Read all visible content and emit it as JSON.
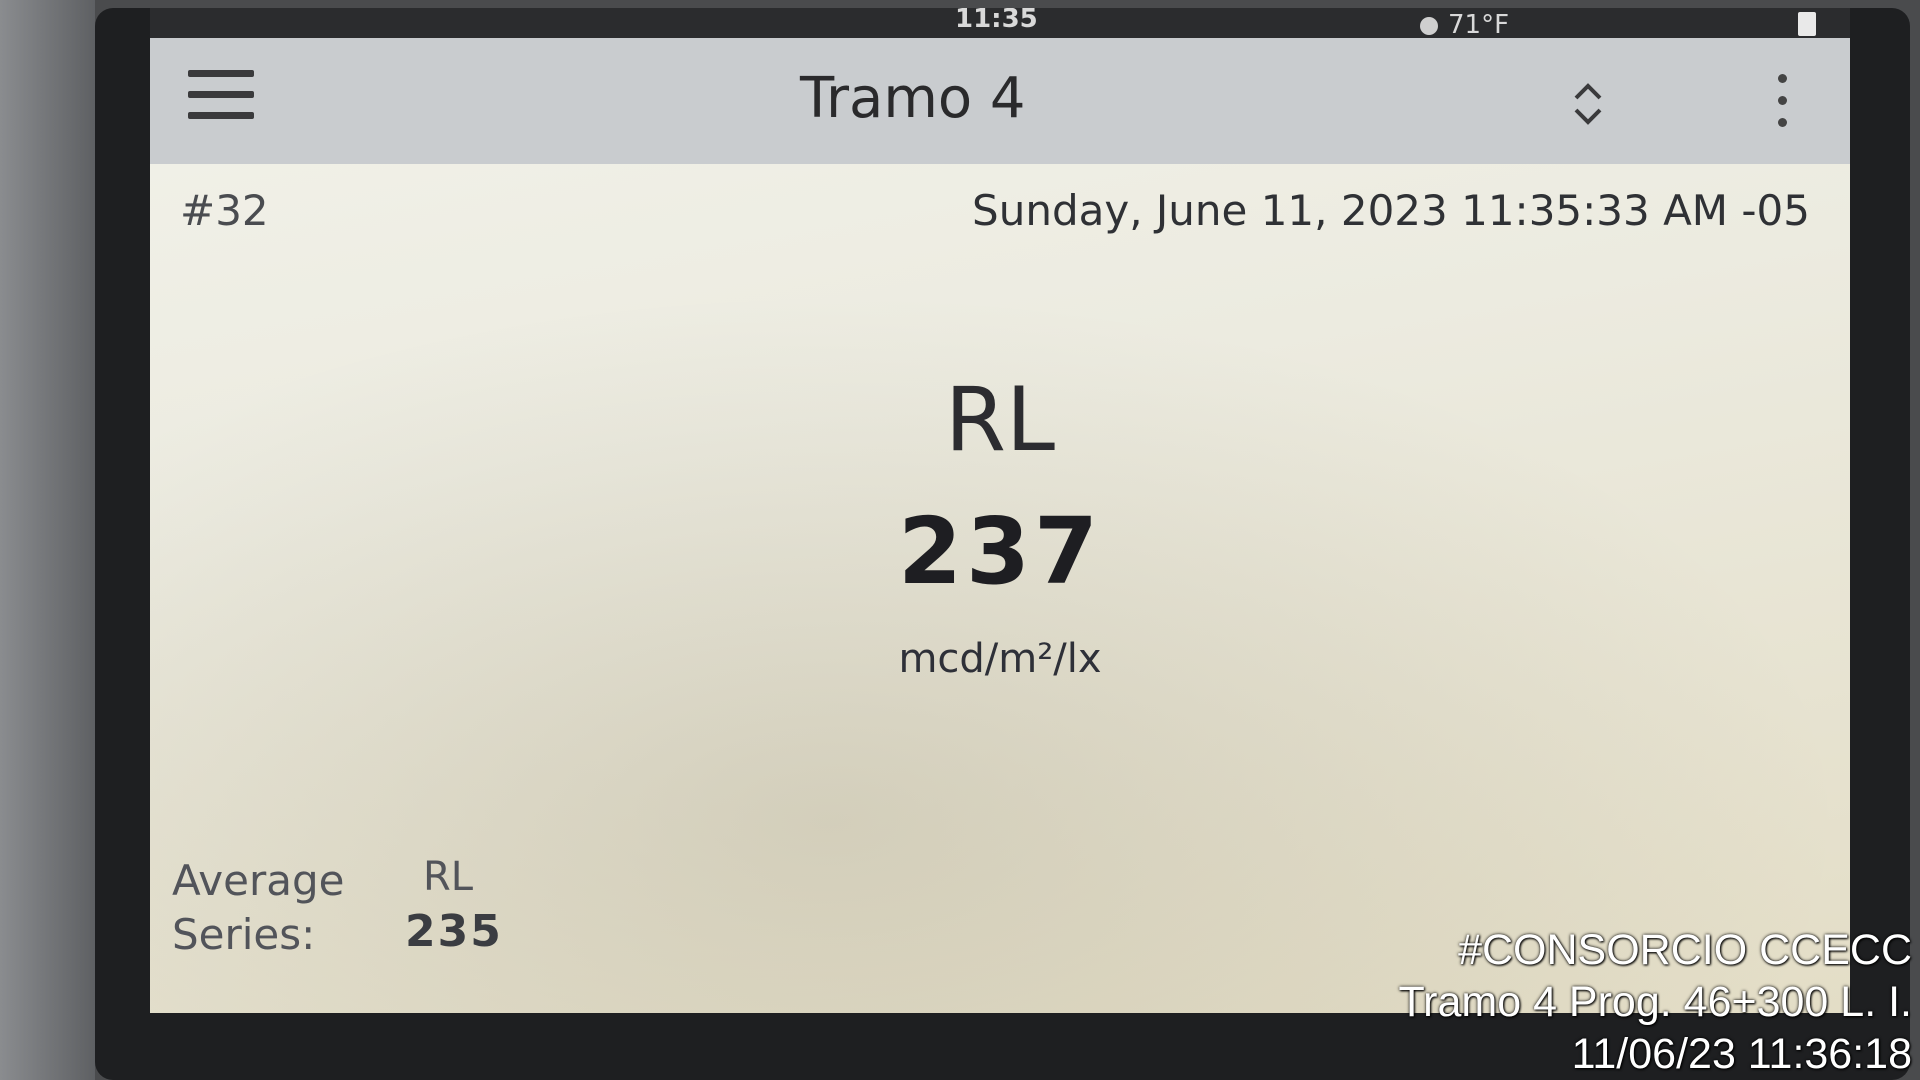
{
  "status_bar": {
    "time": "11:35",
    "temperature": "71°F"
  },
  "app_bar": {
    "title": "Tramo 4",
    "menu_icon": "hamburger-menu-icon",
    "sort_icon": "sort-up-down-icon",
    "more_icon": "more-vertical-icon"
  },
  "record": {
    "number": "#32",
    "timestamp": "Sunday, June 11, 2023 11:35:33 AM -05"
  },
  "measurement": {
    "label": "RL",
    "value": "237",
    "unit": "mcd/m²/lx"
  },
  "average": {
    "label_line1": "Average",
    "label_line2": "Series:",
    "metric": "RL",
    "value": "235"
  },
  "watermark": {
    "line1": "#CONSORCIO CCECC",
    "line2": "Tramo 4 Prog. 46+300 L. I.",
    "line3": "11/06/23  11:36:18"
  }
}
